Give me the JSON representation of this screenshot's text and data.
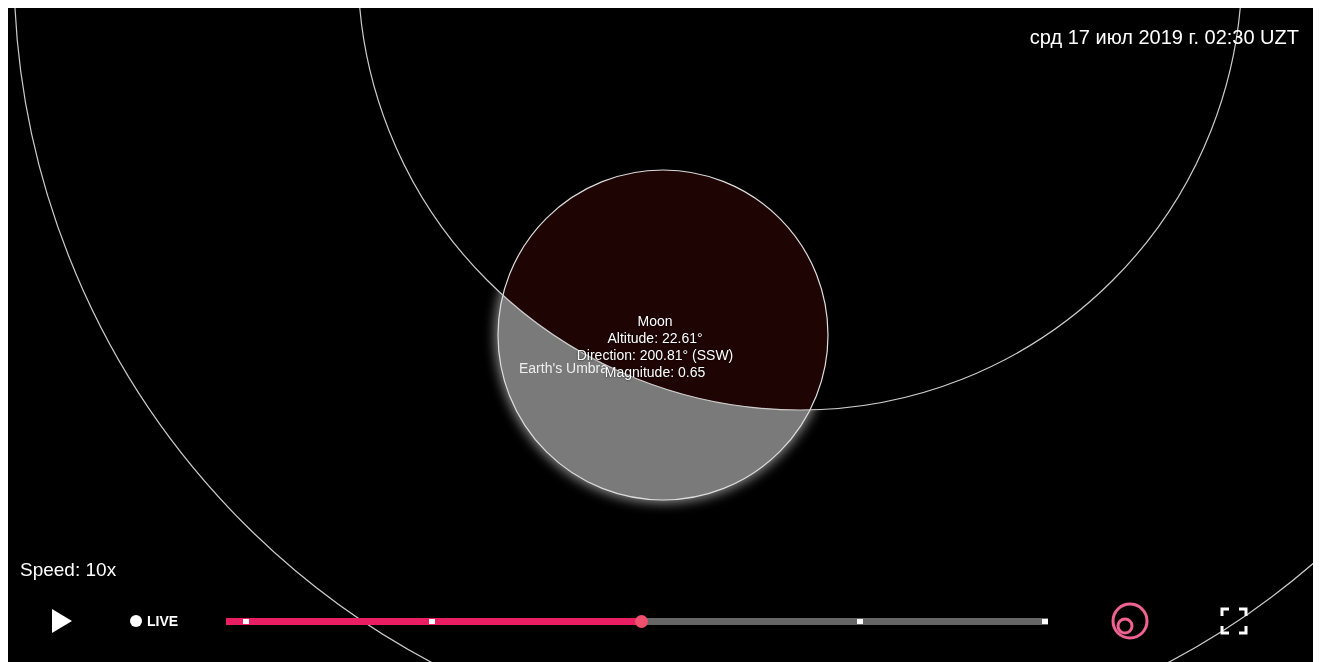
{
  "datetime": "срд 17 июл 2019 г. 02:30 UZT",
  "moon_label": [
    "Moon",
    "Altitude: 22.61°",
    "Direction: 200.81° (SSW)",
    "Magnitude: 0.65"
  ],
  "umbra_label": "Earth's Umbra",
  "speed": "Speed: 10x",
  "controls": {
    "live": "LIVE",
    "timeline": {
      "level": 0.505
    }
  }
}
